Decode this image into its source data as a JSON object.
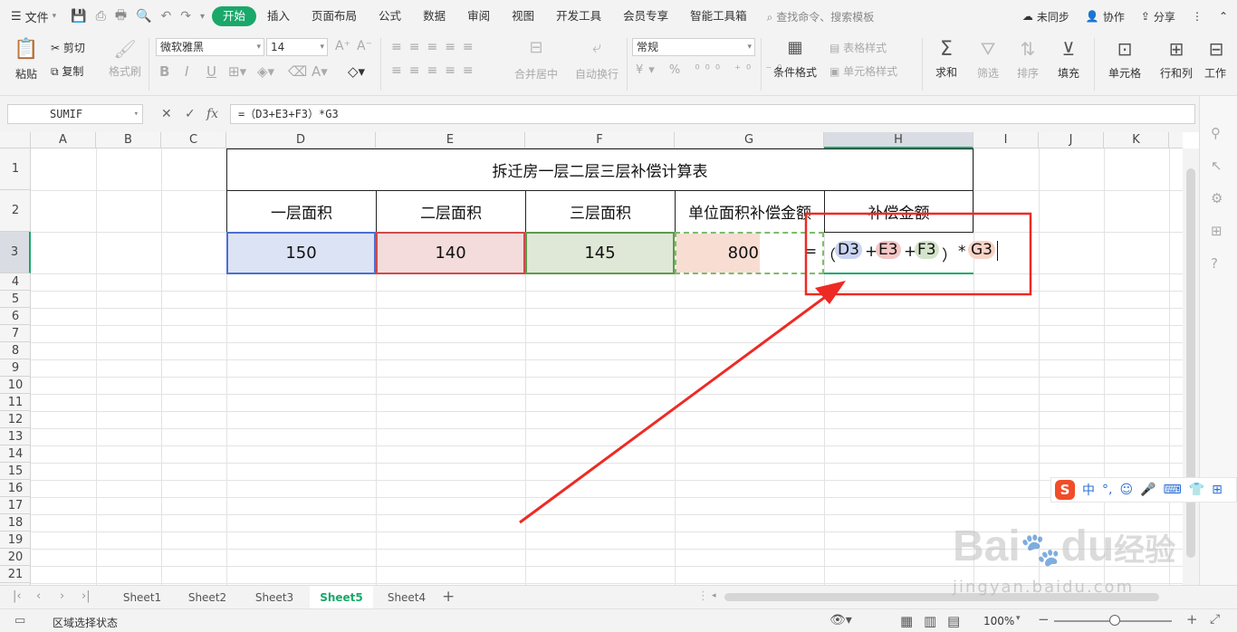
{
  "menubar": {
    "file_label": "文件",
    "tabs": [
      "开始",
      "插入",
      "页面布局",
      "公式",
      "数据",
      "审阅",
      "视图",
      "开发工具",
      "会员专享",
      "智能工具箱"
    ],
    "active_tab": "开始",
    "search": "查找命令、搜索模板",
    "sync": "未同步",
    "collab": "协作",
    "share": "分享"
  },
  "ribbon": {
    "paste": "粘贴",
    "cut": "剪切",
    "copy": "复制",
    "format_painter": "格式刷",
    "font_name": "微软雅黑",
    "font_size": "14",
    "merge": "合并居中",
    "wrap": "自动换行",
    "number_format": "常规",
    "cond_format": "条件格式",
    "table_style": "表格样式",
    "cell_style": "单元格样式",
    "sum": "求和",
    "filter": "筛选",
    "sort": "排序",
    "fill": "填充",
    "cells": "单元格",
    "rows_cols": "行和列",
    "worksheet": "工作"
  },
  "formula_bar": {
    "name_box": "SUMIF",
    "fx": "fx",
    "formula": "=（D3+E3+F3）*G3"
  },
  "grid": {
    "columns": [
      "A",
      "B",
      "C",
      "D",
      "E",
      "F",
      "G",
      "H",
      "I",
      "J",
      "K"
    ],
    "selected_column": "H",
    "rows": [
      "1",
      "2",
      "3",
      "4",
      "5",
      "6",
      "7",
      "8",
      "9",
      "10",
      "11",
      "12",
      "13",
      "14",
      "15",
      "16",
      "17",
      "18",
      "19",
      "20",
      "21"
    ],
    "selected_row": "3",
    "title": "拆迁房一层二层三层补偿计算表",
    "headers": [
      "一层面积",
      "二层面积",
      "三层面积",
      "单位面积补偿金额",
      "补偿金额"
    ],
    "values": [
      "150",
      "140",
      "145",
      "800"
    ],
    "edit_formula": {
      "eq": "=",
      "open": "（",
      "ref1": "D3",
      "plus1": "+",
      "ref2": "E3",
      "plus2": "+",
      "ref3": "F3",
      "close": "）",
      "times": "*",
      "ref4": "G3"
    }
  },
  "colors": {
    "accent": "#1aa86a",
    "d3_fill": "#dce3f5",
    "e3_fill": "#f5dcdc",
    "f3_fill": "#dfe8d6",
    "g3_fill": "#f8ddd3",
    "annotation": "#ee2a24"
  },
  "sheets": [
    "Sheet1",
    "Sheet2",
    "Sheet3",
    "Sheet5",
    "Sheet4"
  ],
  "active_sheet": "Sheet5",
  "statusbar": {
    "mode": "区域选择状态",
    "zoom": "100%"
  },
  "ime": {
    "lang": "中"
  },
  "watermark": {
    "brand": "Bai",
    "brand2": "du",
    "suffix": "经验",
    "url": "jingyan.baidu.com"
  }
}
